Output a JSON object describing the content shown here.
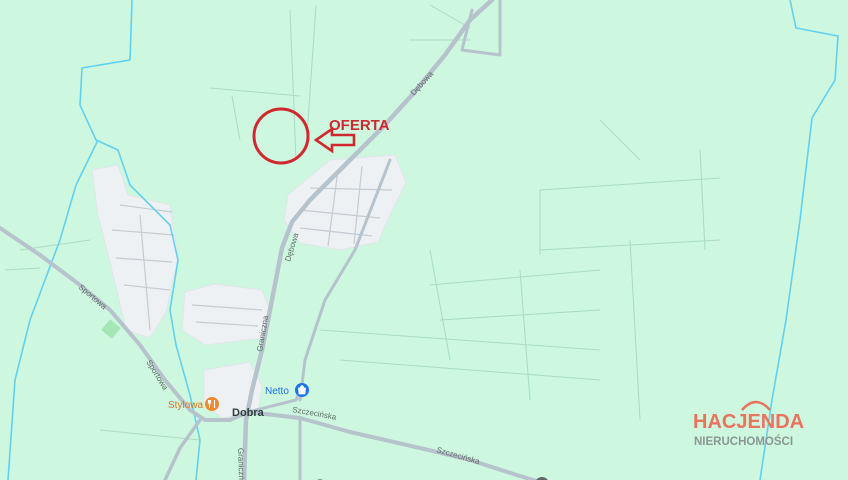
{
  "map": {
    "town_label": "Dobra",
    "streets": {
      "debowa_north": "Dębowa",
      "debowa_south": "Dębowa",
      "graniczna_north": "Graniczna",
      "graniczna_south": "Graniczna",
      "sportowa_north": "Sportowa",
      "sportowa_south": "Sportowa",
      "szczecinska_west": "Szczecińska",
      "szczecinska_east": "Szczecińska"
    },
    "pois": {
      "netto": "Netto",
      "stylowa": "Stylowa"
    },
    "colors": {
      "land": "#cdf7df",
      "road": "#b6c2cc",
      "water": "#61d1ef",
      "builtup": "#eef1f4",
      "marker": "#d0282e",
      "shop_poi": "#1a73e8",
      "food_poi": "#ef8a31"
    }
  },
  "annotation": {
    "label": "OFERTA",
    "shape": "circle",
    "pointer": "arrow-left"
  },
  "watermark": {
    "brand": "HACJENDA",
    "tagline": "NIERUCHOMOŚCI"
  }
}
